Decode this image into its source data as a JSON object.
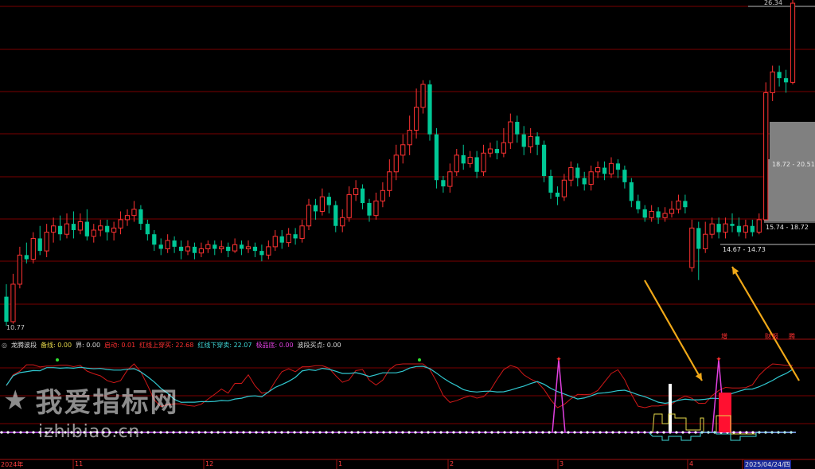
{
  "price_panel": {
    "high_label": "26.34",
    "low_label": "10.77",
    "zones": [
      {
        "label": "18.72 - 20.51"
      },
      {
        "label": "15.74 - 18.72"
      },
      {
        "label": "14.67 - 14.73"
      }
    ],
    "event_tags": [
      {
        "label": "增",
        "color": "#ff3030"
      },
      {
        "label": "财",
        "color": "#ff3030"
      },
      {
        "label": "报",
        "color": "#ff3030"
      },
      {
        "label": "腾",
        "color": "#ff3030"
      }
    ],
    "candles": [
      [
        12.2,
        11.0,
        12.8,
        10.8
      ],
      [
        11.0,
        12.8,
        13.3,
        10.9
      ],
      [
        12.8,
        14.2,
        14.6,
        12.6
      ],
      [
        14.2,
        14.0,
        14.8,
        13.8
      ],
      [
        14.0,
        15.0,
        15.3,
        13.8
      ],
      [
        15.0,
        14.4,
        15.6,
        14.2
      ],
      [
        14.4,
        15.3,
        15.7,
        14.1
      ],
      [
        15.3,
        15.6,
        16.0,
        14.8
      ],
      [
        15.6,
        15.2,
        16.1,
        14.9
      ],
      [
        15.2,
        15.7,
        16.2,
        15.0
      ],
      [
        15.7,
        15.4,
        16.3,
        15.0
      ],
      [
        15.4,
        15.8,
        16.2,
        15.2
      ],
      [
        15.8,
        15.1,
        16.4,
        14.9
      ],
      [
        15.1,
        15.4,
        15.7,
        14.8
      ],
      [
        15.4,
        15.6,
        15.9,
        15.1
      ],
      [
        15.6,
        15.3,
        15.9,
        14.9
      ],
      [
        15.3,
        15.5,
        15.8,
        14.9
      ],
      [
        15.5,
        15.9,
        16.3,
        15.2
      ],
      [
        15.9,
        16.1,
        16.4,
        15.6
      ],
      [
        16.1,
        16.4,
        16.8,
        15.8
      ],
      [
        16.4,
        15.7,
        16.6,
        15.4
      ],
      [
        15.7,
        15.2,
        15.9,
        14.9
      ],
      [
        15.2,
        14.7,
        15.4,
        14.4
      ],
      [
        14.7,
        14.5,
        15.0,
        14.2
      ],
      [
        14.5,
        14.9,
        15.2,
        14.3
      ],
      [
        14.9,
        14.6,
        15.1,
        14.3
      ],
      [
        14.6,
        14.4,
        14.9,
        14.0
      ],
      [
        14.4,
        14.6,
        14.9,
        14.2
      ],
      [
        14.6,
        14.3,
        14.8,
        14.0
      ],
      [
        14.3,
        14.5,
        14.8,
        14.1
      ],
      [
        14.5,
        14.7,
        14.9,
        14.3
      ],
      [
        14.7,
        14.5,
        14.9,
        14.2
      ],
      [
        14.5,
        14.6,
        14.9,
        14.3
      ],
      [
        14.6,
        14.4,
        14.8,
        14.1
      ],
      [
        14.4,
        14.7,
        15.0,
        14.3
      ],
      [
        14.7,
        14.5,
        14.9,
        14.2
      ],
      [
        14.5,
        14.6,
        14.9,
        14.3
      ],
      [
        14.6,
        14.4,
        14.8,
        14.1
      ],
      [
        14.4,
        14.2,
        14.7,
        13.9
      ],
      [
        14.2,
        14.6,
        14.9,
        14.0
      ],
      [
        14.6,
        15.1,
        15.4,
        14.4
      ],
      [
        15.1,
        14.8,
        15.4,
        14.5
      ],
      [
        14.8,
        15.2,
        15.5,
        14.6
      ],
      [
        15.2,
        15.0,
        15.5,
        14.7
      ],
      [
        15.0,
        15.6,
        15.9,
        14.8
      ],
      [
        15.6,
        16.6,
        16.9,
        15.4
      ],
      [
        16.6,
        16.3,
        16.9,
        15.9
      ],
      [
        16.3,
        17.0,
        17.4,
        16.1
      ],
      [
        17.0,
        16.6,
        17.2,
        16.2
      ],
      [
        16.6,
        15.6,
        16.8,
        15.3
      ],
      [
        15.6,
        16.0,
        16.4,
        15.3
      ],
      [
        16.0,
        17.1,
        17.5,
        15.8
      ],
      [
        17.1,
        17.4,
        17.8,
        16.8
      ],
      [
        17.4,
        16.7,
        17.6,
        16.4
      ],
      [
        16.7,
        16.1,
        16.9,
        15.8
      ],
      [
        16.1,
        16.8,
        17.2,
        15.9
      ],
      [
        16.8,
        17.3,
        17.7,
        16.5
      ],
      [
        17.3,
        18.2,
        18.8,
        17.0
      ],
      [
        18.2,
        19.0,
        19.5,
        17.8
      ],
      [
        19.0,
        19.5,
        20.0,
        18.6
      ],
      [
        19.5,
        20.2,
        20.9,
        19.0
      ],
      [
        20.2,
        21.3,
        22.2,
        19.8
      ],
      [
        21.3,
        22.4,
        22.6,
        21.0
      ],
      [
        22.4,
        20.0,
        22.6,
        19.7
      ],
      [
        20.0,
        17.8,
        20.3,
        17.4
      ],
      [
        17.8,
        17.5,
        18.0,
        17.2
      ],
      [
        17.5,
        18.2,
        18.6,
        17.2
      ],
      [
        18.2,
        19.0,
        19.3,
        18.0
      ],
      [
        19.0,
        18.6,
        19.5,
        18.3
      ],
      [
        18.6,
        18.9,
        19.2,
        18.4
      ],
      [
        18.9,
        18.2,
        19.2,
        17.9
      ],
      [
        18.2,
        19.1,
        19.5,
        18.0
      ],
      [
        19.1,
        19.3,
        19.6,
        18.9
      ],
      [
        19.3,
        19.1,
        19.7,
        18.8
      ],
      [
        19.1,
        19.6,
        20.3,
        18.9
      ],
      [
        19.6,
        20.6,
        21.0,
        19.3
      ],
      [
        20.6,
        20.0,
        20.9,
        19.6
      ],
      [
        20.0,
        19.4,
        20.4,
        19.0
      ],
      [
        19.4,
        19.9,
        20.3,
        19.1
      ],
      [
        19.9,
        19.5,
        20.1,
        19.0
      ],
      [
        19.5,
        18.0,
        19.7,
        17.7
      ],
      [
        18.0,
        17.2,
        18.3,
        16.9
      ],
      [
        17.2,
        17.0,
        17.5,
        16.6
      ],
      [
        17.0,
        17.8,
        18.1,
        16.8
      ],
      [
        17.8,
        18.4,
        18.7,
        17.5
      ],
      [
        18.4,
        17.9,
        18.6,
        17.5
      ],
      [
        17.9,
        17.6,
        18.2,
        17.3
      ],
      [
        17.6,
        18.2,
        18.5,
        17.3
      ],
      [
        18.2,
        18.4,
        18.7,
        17.9
      ],
      [
        18.4,
        18.1,
        18.7,
        17.8
      ],
      [
        18.1,
        18.6,
        18.9,
        17.9
      ],
      [
        18.6,
        18.3,
        18.8,
        17.9
      ],
      [
        18.3,
        17.7,
        18.5,
        17.4
      ],
      [
        17.7,
        16.8,
        17.9,
        16.5
      ],
      [
        16.8,
        16.4,
        17.1,
        16.2
      ],
      [
        16.4,
        16.0,
        16.6,
        15.8
      ],
      [
        16.0,
        16.3,
        16.6,
        15.8
      ],
      [
        16.3,
        16.0,
        16.5,
        15.7
      ],
      [
        16.0,
        16.2,
        16.5,
        15.8
      ],
      [
        16.2,
        16.4,
        16.8,
        16.0
      ],
      [
        16.4,
        16.8,
        17.1,
        16.2
      ],
      [
        16.8,
        16.5,
        17.1,
        16.2
      ],
      [
        13.6,
        15.5,
        15.9,
        13.4
      ],
      [
        15.5,
        14.5,
        15.8,
        13.0
      ],
      [
        14.5,
        15.2,
        15.8,
        14.3
      ],
      [
        15.2,
        15.7,
        16.0,
        15.0
      ],
      [
        15.7,
        15.3,
        16.0,
        15.0
      ],
      [
        15.3,
        15.7,
        16.0,
        15.0
      ],
      [
        15.7,
        15.6,
        16.2,
        15.3
      ],
      [
        15.6,
        15.3,
        16.0,
        15.1
      ],
      [
        15.3,
        15.6,
        15.9,
        15.0
      ],
      [
        15.6,
        15.3,
        15.9,
        15.1
      ],
      [
        15.3,
        15.9,
        16.2,
        15.2
      ],
      [
        15.9,
        22.0,
        22.5,
        15.9
      ],
      [
        22.0,
        23.0,
        23.3,
        21.6
      ],
      [
        23.0,
        22.7,
        23.3,
        22.3
      ],
      [
        22.7,
        22.5,
        23.1,
        22.0
      ],
      [
        22.5,
        26.3,
        26.6,
        22.4
      ]
    ]
  },
  "indicator_panel": {
    "name": "龙腾波段",
    "fields": [
      {
        "label": "备线:",
        "value": "0.00",
        "color": "#e6d84a"
      },
      {
        "label": "界:",
        "value": "0.00",
        "color": "#dcdcdc"
      },
      {
        "label": "启动:",
        "value": "0.01",
        "color": "#ff3030"
      },
      {
        "label": "红线上穿买:",
        "value": "22.68",
        "color": "#ff3030"
      },
      {
        "label": "红线下穿卖:",
        "value": "22.07",
        "color": "#3fd8d8"
      },
      {
        "label": "极品底:",
        "value": "0.00",
        "color": "#e040e0"
      },
      {
        "label": "波段买点:",
        "value": "0.00",
        "color": "#dcdcdc"
      }
    ]
  },
  "x_axis": {
    "labels": [
      "2024年",
      "11",
      "12",
      "1",
      "2",
      "3",
      "4",
      "2025/04/24/四"
    ]
  },
  "watermark": {
    "title": "我爱指标网",
    "url": "izhibiao.cn"
  },
  "colors": {
    "up": "#ff3232",
    "down": "#00c896",
    "grid": "#7a0000",
    "background": "#000000",
    "red_line": "#d01818",
    "cyan_line": "#30c8d0",
    "magenta": "#e040e0",
    "arrow": "#f0a818",
    "zone_fill": "#808080"
  }
}
